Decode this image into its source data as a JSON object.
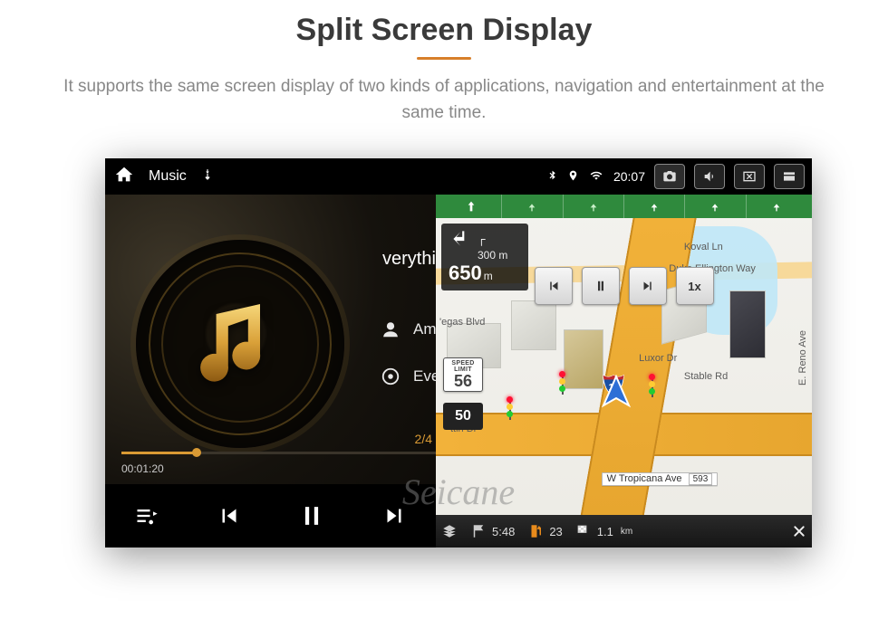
{
  "page": {
    "title": "Split Screen Display",
    "subtitle": "It supports the same screen display of two kinds of applications, navigation and entertainment at the same time."
  },
  "statusbar": {
    "app_name": "Music",
    "clock": "20:07"
  },
  "music": {
    "track_title": "verythin",
    "artist": "Ame",
    "album": "Ever",
    "track_counter": "2/4",
    "time_current": "00:01:20",
    "time_total": ""
  },
  "nav": {
    "turn": {
      "primary_distance": "650",
      "primary_unit": "m",
      "secondary_distance": "300",
      "secondary_unit": "m"
    },
    "speed_limit_label_top": "SPEED",
    "speed_limit_label_bottom": "LIMIT",
    "speed_limit_value": "56",
    "current_speed": "50",
    "sim_speed": "1x",
    "streets": {
      "top_main": "S Las Vegas Blvd",
      "koval": "Koval Ln",
      "duke": "Duke Ellington Way",
      "luxor": "Luxor Dr",
      "stable": "Stable Rd",
      "reno": "E. Reno Ave",
      "tropicana": "W Tropicana Ave",
      "tropicana_num": "593",
      "ttin": "ttin Dr",
      "vegas_frag": "'egas Blvd"
    },
    "interstate": "15",
    "bottom": {
      "eta": "5:48",
      "fuel": "23",
      "trip_dist": "1.1",
      "trip_unit": "km"
    }
  },
  "watermark": "Seicane"
}
